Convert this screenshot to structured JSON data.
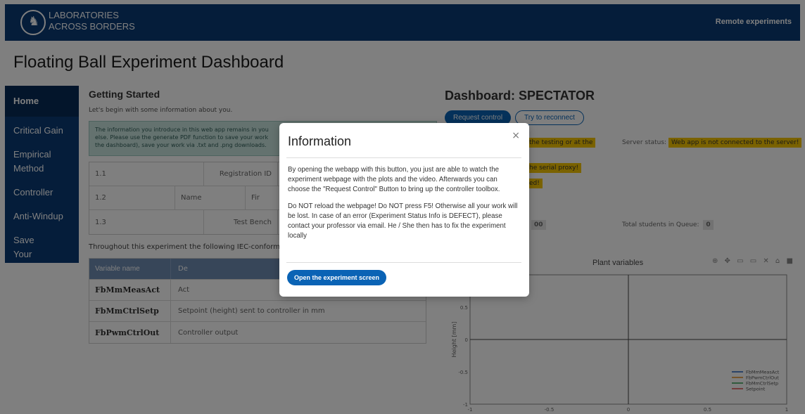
{
  "header": {
    "brand_line1": "LABORATORIES",
    "brand_line2": "ACROSS BORDERS",
    "nav_link": "Remote experiments"
  },
  "page_title": "Floating Ball Experiment Dashboard",
  "sidebar": {
    "items": [
      {
        "label": "Home"
      },
      {
        "label": "Critical Gain"
      },
      {
        "label": "Empirical Method"
      },
      {
        "label": "Controller"
      },
      {
        "label": "Anti-Windup"
      },
      {
        "label": "Save Your Work"
      }
    ]
  },
  "getting_started": {
    "title": "Getting Started",
    "intro": "Let's begin with some information about you.",
    "info_line1": "The information you introduce in this web app remains in you",
    "info_line2": "else. Please use the generate PDF function to save your work",
    "info_line3": "the dashboard), save your work via .txt and .png downloads.",
    "form_rows": [
      {
        "num": "1.1",
        "label": "Registration ID"
      },
      {
        "num": "1.2",
        "label": "Name",
        "label2": "Fir"
      },
      {
        "num": "1.3",
        "label": "Test Bench"
      }
    ],
    "paragraph": "Throughout this experiment the following IEC-conform sy",
    "var_table": {
      "header_col1": "Variable name",
      "header_col2": "De",
      "rows": [
        {
          "name": "FbMmMeasAct",
          "desc": "Act"
        },
        {
          "name": "FbMmCtrlSetp",
          "desc": "Setpoint (height) sent to controller in mm"
        },
        {
          "name": "FbPwmCtrlOut",
          "desc": "Controller output"
        }
      ]
    }
  },
  "dashboard": {
    "title": "Dashboard: SPECTATOR",
    "request_button": "Request control",
    "reconnect_button": "Try to reconnect",
    "status_partial_1": "the testing or at the",
    "server_status_label": "Server status:",
    "server_status_value": "Web app is not connected to the server!",
    "status_partial_2": "he serial proxy!",
    "status_partial_3": "ed!",
    "time_partial": "00",
    "queue_label": "Total students in Queue:",
    "queue_value": "0"
  },
  "chart_data": {
    "type": "line",
    "title": "Plant variables",
    "xlabel": "",
    "ylabel": "Height [mm]",
    "xlim": [
      -1,
      1
    ],
    "ylim": [
      -1,
      1
    ],
    "x_ticks": [
      "-1",
      "-0.5",
      "0",
      "0.5",
      "1"
    ],
    "y_ticks": [
      "0.5",
      "0",
      "-0.5",
      "-1"
    ],
    "legend_position": "bottom-right",
    "series": [
      {
        "name": "FbMmMeasAct",
        "color": "#1f5fbf",
        "values": []
      },
      {
        "name": "FbPwmCtrlOut",
        "color": "#e08a1e",
        "values": []
      },
      {
        "name": "FbMmCtrlSetp",
        "color": "#2e9e4a",
        "values": []
      },
      {
        "name": "Setpoint",
        "color": "#d94c4c",
        "values": []
      }
    ]
  },
  "modal": {
    "title": "Information",
    "close_symbol": "×",
    "paragraph1": "By opening the webapp with this button, you just are able to watch the experiment webpage with the plots and the video. Afterwards you can choose the \"Request Control\" Button to bring up the controller toolbox.",
    "paragraph2": "Do NOT reload the webpage! Do NOT press F5! Otherwise all your work will be lost. In case of an error (Experiment Status Info is DEFECT), please contact your professor via email. He / She then has to fix the experiment locally",
    "button_label": "Open the experiment screen"
  }
}
